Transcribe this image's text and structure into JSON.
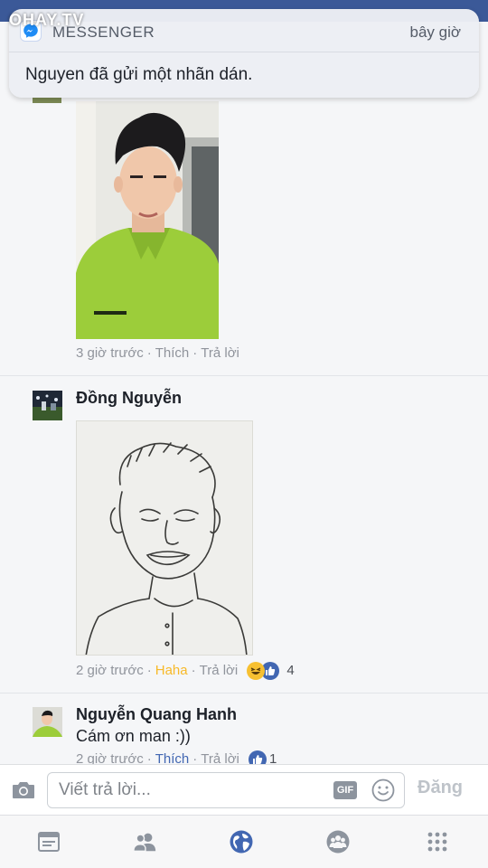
{
  "watermark": "OHAY.TV",
  "notification": {
    "app": "MESSENGER",
    "time": "bây giờ",
    "message": "Nguyen đã gửi một nhãn dán."
  },
  "comments": [
    {
      "meta": {
        "time": "3 giờ trước",
        "action": "Thích",
        "reply": "Trả lời"
      }
    },
    {
      "name": "Đồng Nguyễn",
      "meta": {
        "time": "2 giờ trước",
        "action": "Haha",
        "reply": "Trả lời",
        "reaction_count": "4"
      }
    },
    {
      "name": "Nguyễn Quang Hanh",
      "text": "Cám ơn man :))",
      "meta": {
        "time": "2 giờ trước",
        "action": "Thích",
        "reply": "Trả lời",
        "reaction_count": "1"
      }
    }
  ],
  "reply_bar": {
    "placeholder": "Viết trả lời...",
    "gif_label": "GIF",
    "post_label": "Đăng"
  },
  "tabs": [
    {
      "icon": "news-feed-icon"
    },
    {
      "icon": "friends-icon"
    },
    {
      "icon": "globe-icon"
    },
    {
      "icon": "groups-icon"
    },
    {
      "icon": "menu-grid-icon"
    }
  ],
  "colors": {
    "brand": "#3b5998",
    "link": "#4267b2",
    "haha": "#f7b928",
    "meta_text": "#90949c",
    "shirt": "#9ccd3a"
  }
}
